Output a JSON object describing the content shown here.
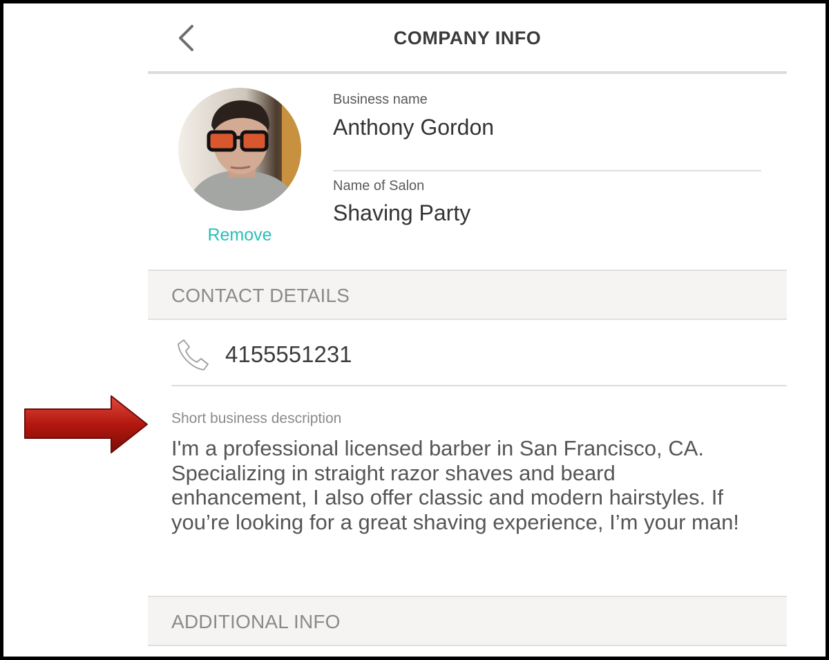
{
  "header": {
    "title": "COMPANY INFO",
    "back_icon": "chevron-left-icon"
  },
  "profile": {
    "avatar_icon": "avatar",
    "remove_label": "Remove",
    "business_name_label": "Business name",
    "business_name_value": "Anthony Gordon",
    "salon_name_label": "Name of Salon",
    "salon_name_value": "Shaving Party"
  },
  "contact": {
    "section_title": "CONTACT DETAILS",
    "phone_icon": "phone-icon",
    "phone_value": "4155551231"
  },
  "description": {
    "label": "Short business description",
    "text": "I'm a professional licensed barber in San Francisco, CA. Specializing in straight razor shaves and beard enhancement, I also offer classic and modern hairstyles. If you’re looking for a great shaving experience, I’m your man!"
  },
  "additional": {
    "section_title": "ADDITIONAL INFO"
  },
  "colors": {
    "accent": "#2bbfb7",
    "annotation_arrow": "#b3170f",
    "section_background": "#f5f4f2",
    "title_text": "#3b3b3b"
  }
}
